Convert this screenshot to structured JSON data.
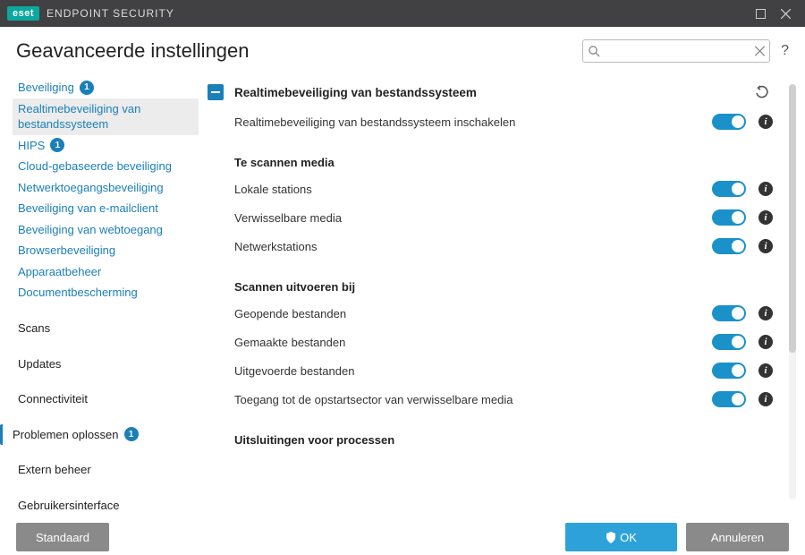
{
  "titlebar": {
    "brand": "eset",
    "product": "ENDPOINT SECURITY"
  },
  "header": {
    "title": "Geavanceerde instellingen",
    "search_placeholder": "",
    "help": "?"
  },
  "sidebar": {
    "items": [
      {
        "label": "Beveiliging",
        "link": true,
        "badge": "1"
      },
      {
        "label": "Realtimebeveiliging van bestandssysteem",
        "link": true,
        "selected": true
      },
      {
        "label": "HIPS",
        "link": true,
        "badge": "1"
      },
      {
        "label": "Cloud-gebaseerde beveiliging",
        "link": true
      },
      {
        "label": "Netwerktoegangsbeveiliging",
        "link": true
      },
      {
        "label": "Beveiliging van e-mailclient",
        "link": true
      },
      {
        "label": "Beveiliging van webtoegang",
        "link": true
      },
      {
        "label": "Browserbeveiliging",
        "link": true
      },
      {
        "label": "Apparaatbeheer",
        "link": true
      },
      {
        "label": "Documentbescherming",
        "link": true
      },
      {
        "label": "Scans",
        "top": true
      },
      {
        "label": "Updates",
        "top": true
      },
      {
        "label": "Connectiviteit",
        "top": true
      },
      {
        "label": "Problemen oplossen",
        "top": true,
        "badge": "1",
        "bar": true
      },
      {
        "label": "Extern beheer",
        "top": true
      },
      {
        "label": "Gebruikersinterface",
        "top": true
      }
    ]
  },
  "main": {
    "section_title": "Realtimebeveiliging van bestandssysteem",
    "rows1": [
      {
        "label": "Realtimebeveiliging van bestandssysteem inschakelen",
        "on": true
      }
    ],
    "subhead1": "Te scannen media",
    "rows2": [
      {
        "label": "Lokale stations",
        "on": true
      },
      {
        "label": "Verwisselbare media",
        "on": true
      },
      {
        "label": "Netwerkstations",
        "on": true
      }
    ],
    "subhead2": "Scannen uitvoeren bij",
    "rows3": [
      {
        "label": "Geopende bestanden",
        "on": true
      },
      {
        "label": "Gemaakte bestanden",
        "on": true
      },
      {
        "label": "Uitgevoerde bestanden",
        "on": true
      },
      {
        "label": "Toegang tot de opstartsector van verwisselbare media",
        "on": true
      }
    ],
    "subhead3": "Uitsluitingen voor processen"
  },
  "footer": {
    "default": "Standaard",
    "ok": "OK",
    "cancel": "Annuleren"
  }
}
